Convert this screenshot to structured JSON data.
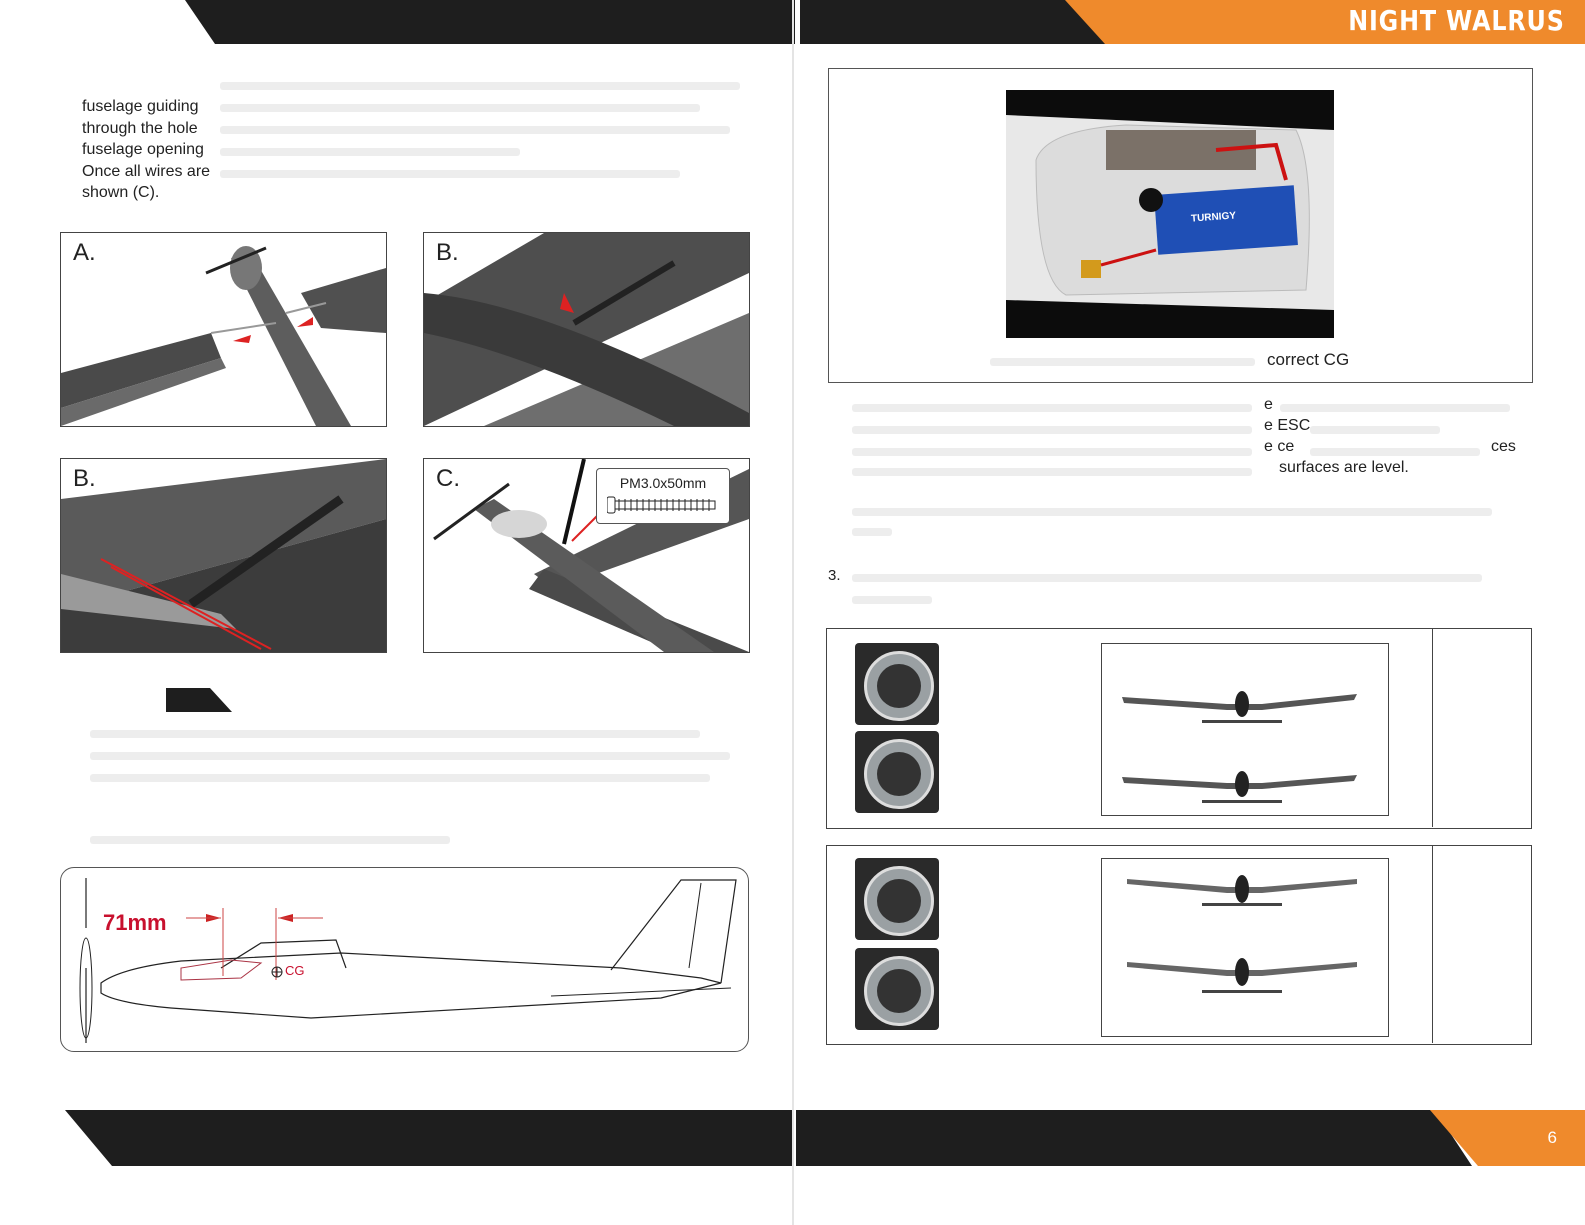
{
  "header": {
    "brand": "NIGHT WALRUS",
    "accent_color": "#ef8a2c",
    "band_color": "#1e1e1e"
  },
  "left_page": {
    "intro_lines": [
      "fuselage guiding",
      "through the hole",
      "fuselage opening",
      "Once all wires are",
      "shown (C)."
    ],
    "figures": [
      {
        "label": "A."
      },
      {
        "label": "B."
      },
      {
        "label": "B."
      },
      {
        "label": "C."
      }
    ],
    "screw_label": "PM3.0x50mm",
    "cg_diagram": {
      "distance": "71mm",
      "cg_label": "CG"
    }
  },
  "right_page": {
    "battery_caption": "correct CG",
    "fragments": [
      "e",
      "e ESC",
      "e ce",
      "ces",
      "surfaces are level."
    ],
    "step_number": "3.",
    "battery_brand": "TURNIGY"
  },
  "footer": {
    "page_number": "6"
  }
}
